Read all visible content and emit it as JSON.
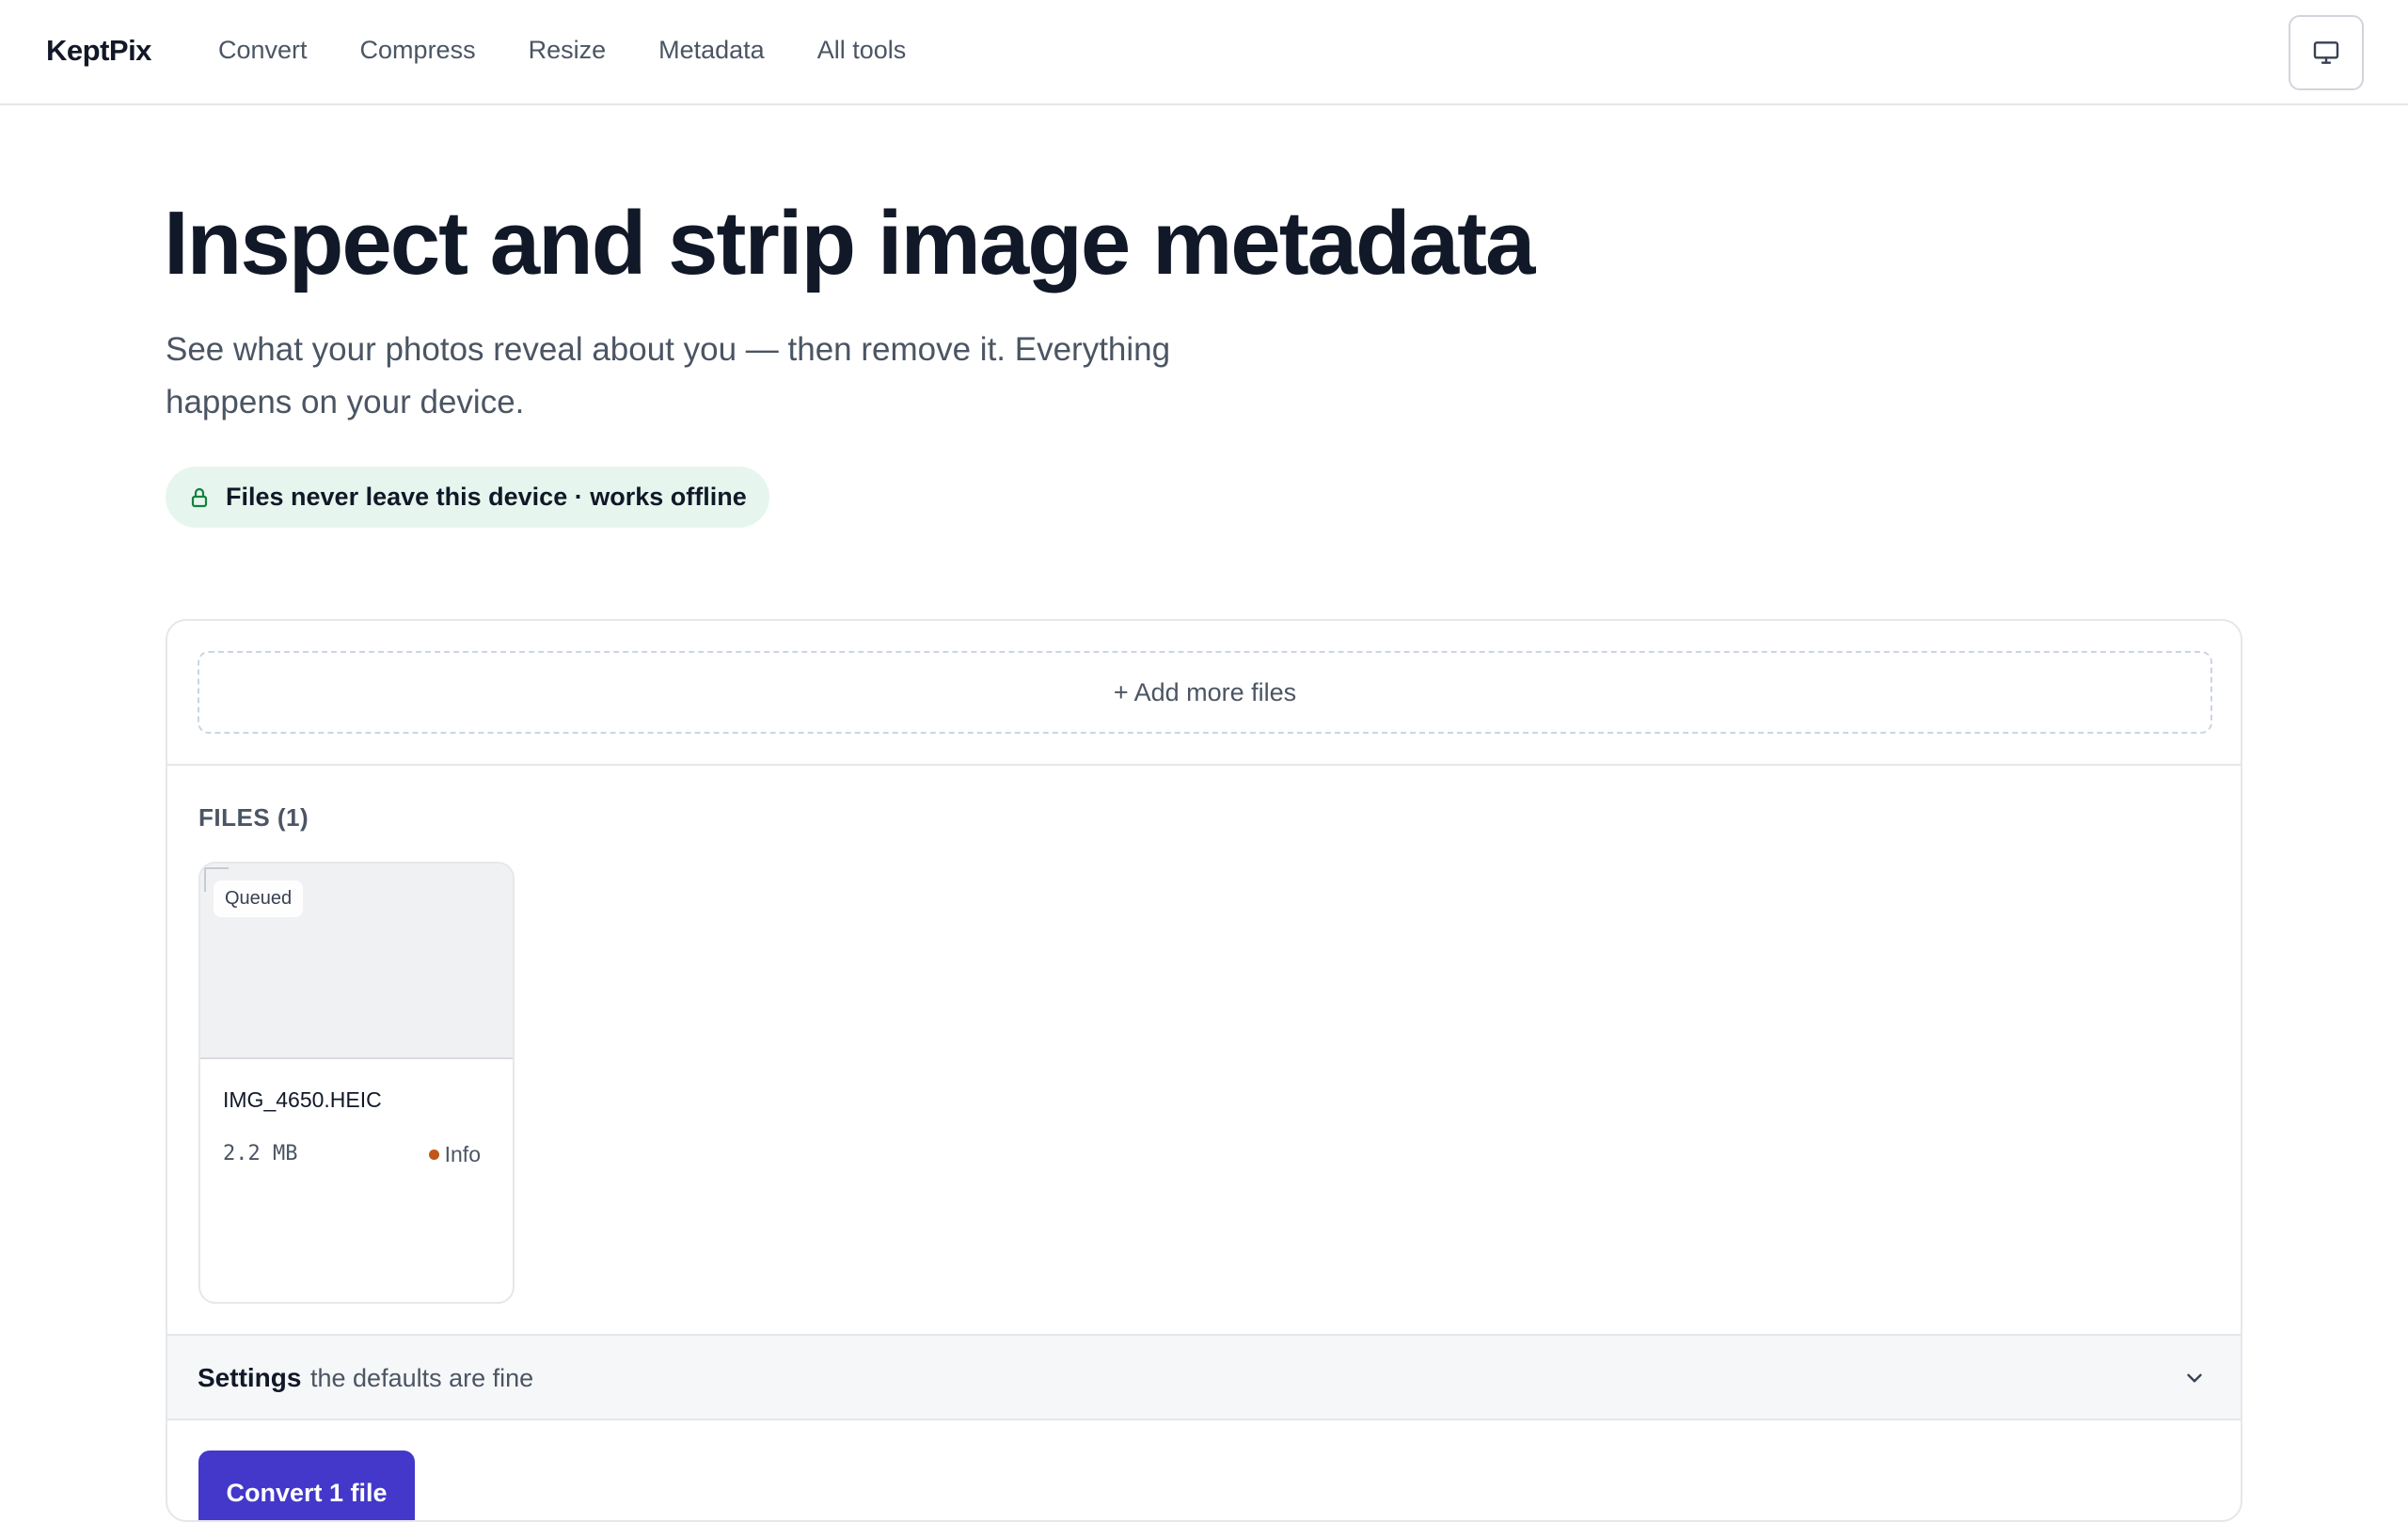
{
  "header": {
    "brand": "KeptPix",
    "nav": [
      "Convert",
      "Compress",
      "Resize",
      "Metadata",
      "All tools"
    ],
    "display_icon": "monitor-icon"
  },
  "hero": {
    "title": "Inspect and strip image metadata",
    "subtitle": "See what your photos reveal about you — then remove it. Everything happens on your device.",
    "privacy_badge": "Files never leave this device · works offline",
    "privacy_icon": "lock-icon"
  },
  "panel": {
    "add_files_label": "+ Add more files",
    "files_heading": "FILES (1)",
    "files": [
      {
        "name": "IMG_4650.HEIC",
        "size": "2.2 MB",
        "status": "Queued",
        "info_label": "Info",
        "info_dot_color": "#c2561a"
      }
    ],
    "settings": {
      "label": "Settings",
      "hint": "the defaults are fine",
      "icon": "chevron-down-icon"
    },
    "convert_label": "Convert 1 file"
  },
  "colors": {
    "accent": "#4338ca",
    "privacy_bg": "#e6f6ee",
    "privacy_icon": "#15803d"
  }
}
